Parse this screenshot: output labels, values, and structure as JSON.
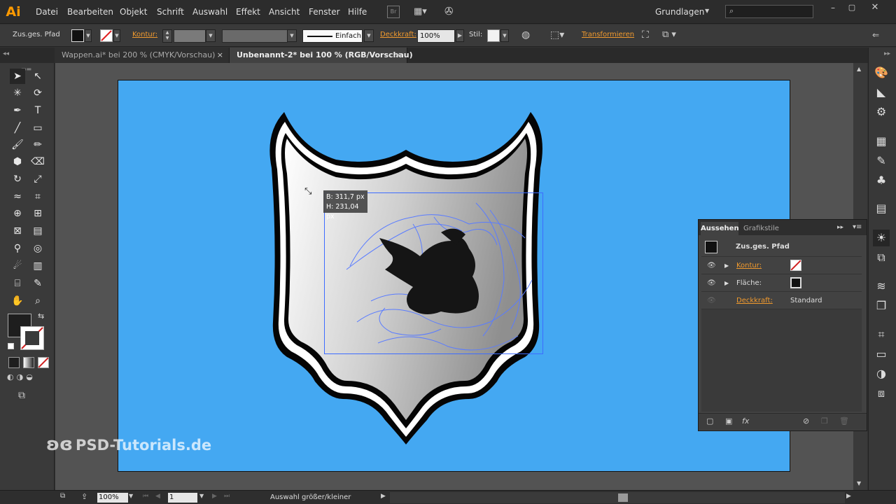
{
  "app": {
    "logo": "Ai"
  },
  "menu": [
    "Datei",
    "Bearbeiten",
    "Objekt",
    "Schrift",
    "Auswahl",
    "Effekt",
    "Ansicht",
    "Fenster",
    "Hilfe"
  ],
  "workspace": {
    "label": "Grundlagen",
    "bridge": "Br"
  },
  "control": {
    "object_type": "Zus.ges. Pfad",
    "stroke_label": "Kontur:",
    "stroke_style": "Einfach",
    "opacity_label": "Deckkraft:",
    "opacity_value": "100%",
    "style_label": "Stil:",
    "transform_label": "Transformieren"
  },
  "tabs": [
    {
      "label": "Wappen.ai* bei 200 % (CMYK/Vorschau)",
      "close": "×"
    },
    {
      "label": "Unbenannt-2* bei 100 % (RGB/Vorschau)",
      "close": "×"
    }
  ],
  "tooltip": {
    "width": "B: 311,7 px",
    "height": "H: 231,04 px"
  },
  "panel": {
    "tabs": [
      "Aussehen",
      "Grafikstile"
    ],
    "object": "Zus.ges. Pfad",
    "rows": [
      {
        "label": "Kontur:",
        "style": "orange"
      },
      {
        "label": "Fläche:",
        "style": "plain"
      },
      {
        "label": "Deckkraft:",
        "value": "Standard"
      }
    ],
    "fx": "fx"
  },
  "status": {
    "zoom": "100%",
    "page": "1",
    "message": "Auswahl größer/kleiner"
  },
  "watermark": "PSD-Tutorials.de",
  "colors": {
    "artboard": "#44a8f2",
    "accent": "#f19a2e"
  }
}
